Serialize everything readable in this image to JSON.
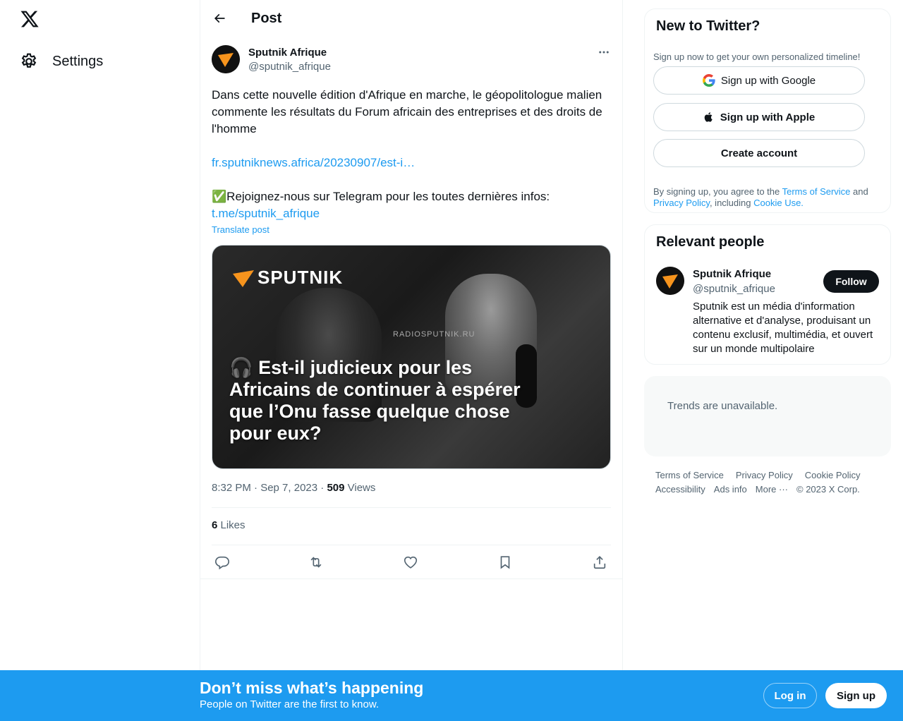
{
  "nav": {
    "settings_label": "Settings"
  },
  "header": {
    "title": "Post"
  },
  "tweet": {
    "author_name": "Sputnik Afrique",
    "author_handle": "@sputnik_afrique",
    "text_line1": "Dans cette nouvelle édition d'Afrique en marche, le géopolitologue malien commente les résultats du Forum africain des entreprises et des droits de l'homme",
    "link1": "fr.sputniknews.africa/20230907/est-i…",
    "text_line2": "✅Rejoignez-nous sur Telegram pour les toutes dernières infos:",
    "link2": "t.me/sputnik_afrique",
    "translate_label": "Translate post",
    "media_logo_text": "SPUTNIK",
    "media_radio_text": "RADIOSPUTNIK.RU",
    "media_caption": "🎧 Est-il judicieux pour les Africains de continuer à espérer que l’Onu fasse quelque chose pour eux?",
    "time": "8:32 PM · Sep 7, 2023 · ",
    "views_count": "509",
    "views_label": " Views",
    "likes_count": "6",
    "likes_label": " Likes"
  },
  "signup_card": {
    "title": "New to Twitter?",
    "subtitle": "Sign up now to get your own personalized timeline!",
    "google_label": "Sign up with Google",
    "apple_label": "Sign up with Apple",
    "create_label": "Create account",
    "legal_prefix": "By signing up, you agree to the ",
    "terms": "Terms of Service",
    "legal_and": " and ",
    "privacy": "Privacy Policy",
    "legal_including": ", including ",
    "cookie": "Cookie Use."
  },
  "relevant": {
    "title": "Relevant people",
    "name": "Sputnik Afrique",
    "handle": "@sputnik_afrique",
    "follow_label": "Follow",
    "bio": "Sputnik est un média d'information alternative et d'analyse, produisant un contenu exclusif, multimédia, et ouvert sur un monde multipolaire"
  },
  "trends": {
    "text": "Trends are unavailable."
  },
  "footer": {
    "row1": [
      "Terms of Service",
      "Privacy Policy",
      "Cookie Policy"
    ],
    "row2": [
      "Accessibility",
      "Ads info",
      "More ···",
      "© 2023 X Corp."
    ]
  },
  "bottom_bar": {
    "title": "Don’t miss what’s happening",
    "subtitle": "People on Twitter are the first to know.",
    "login_label": "Log in",
    "signup_label": "Sign up"
  },
  "colors": {
    "accent": "#1d9bf0",
    "text": "#0f1419",
    "muted": "#536471",
    "sputnik_orange": "#f7941d"
  }
}
